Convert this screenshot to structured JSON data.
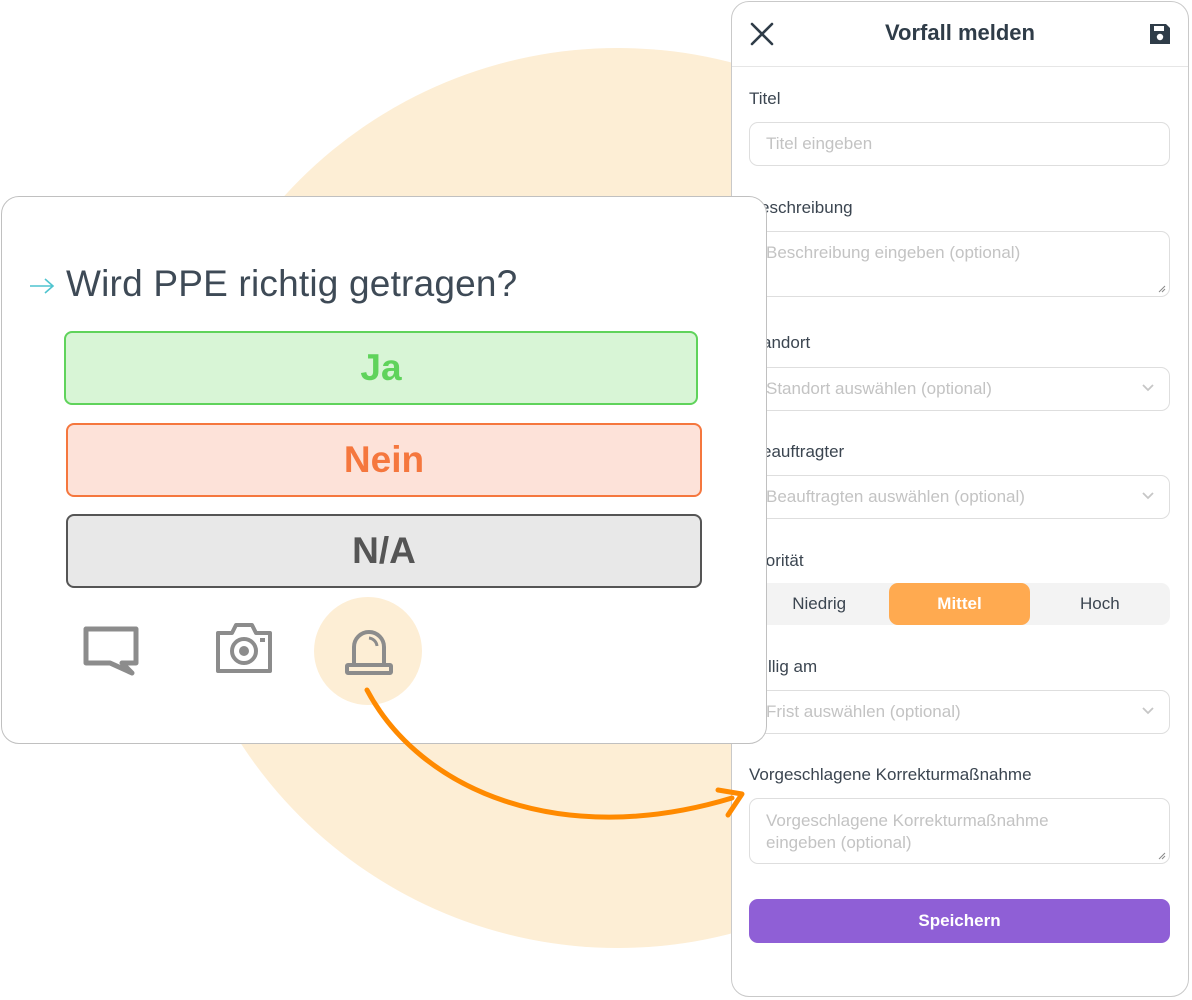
{
  "card": {
    "question": "Wird PPE richtig getragen?",
    "answers": [
      "Ja",
      "Nein",
      "N/A"
    ],
    "tools": [
      "comment-icon",
      "camera-icon",
      "alarm-icon"
    ]
  },
  "panel": {
    "title": "Vorfall melden",
    "fields": {
      "titel": {
        "label": "Titel",
        "placeholder": "Titel eingeben"
      },
      "beschreibung": {
        "label": "eschreibung",
        "placeholder": "Beschreibung eingeben (optional)"
      },
      "standort": {
        "label": "andort",
        "placeholder": "Standort auswählen (optional)"
      },
      "beauftragter": {
        "label": "eauftragter",
        "placeholder": "Beauftragten auswählen (optional)"
      },
      "prioritaet": {
        "label": "iorität",
        "options": [
          "Niedrig",
          "Mittel",
          "Hoch"
        ],
        "selected": "Mittel"
      },
      "faellig": {
        "label": "llig am",
        "placeholder": "Frist auswählen (optional)"
      },
      "korrektur": {
        "label": "Vorgeschlagene Korrekturmaßnahme",
        "placeholder_line1": "Vorgeschlagene Korrekturmaßnahme",
        "placeholder_line2": "eingeben (optional)"
      }
    },
    "save_label": "Speichern"
  },
  "colors": {
    "accent_purple": "#8f5fd6",
    "priority_active": "#ffaa50",
    "yes_green": "#5fd35b",
    "no_orange": "#f5773e",
    "arrow_orange": "#ff8a00",
    "circle_bg": "#fdeed5"
  }
}
